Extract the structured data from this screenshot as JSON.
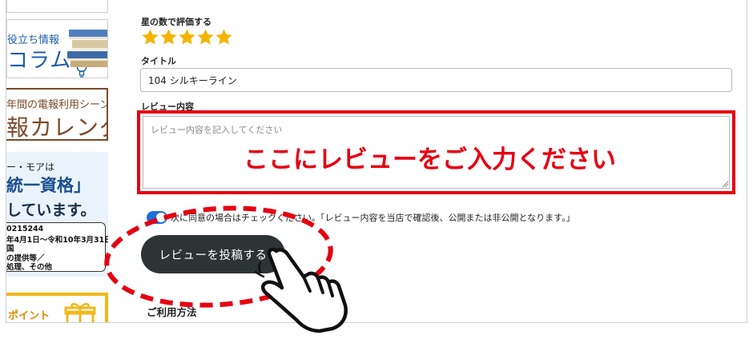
{
  "sidebar": {
    "column_banner": {
      "subtitle": "役立ち情報",
      "title": "コラム"
    },
    "calendar_banner": {
      "subtitle": "年間の電報利用シーン",
      "title": "報カレンダー"
    },
    "license_banner": {
      "line1": "ー・モアは",
      "line2": "統一資格」",
      "line3": "しています。",
      "box_lines": [
        "0215244",
        "年4月1日〜令和10年3月31日",
        "国",
        "の提供等／",
        "処理、その他"
      ]
    },
    "point_banner": {
      "label": "ポイント"
    }
  },
  "form": {
    "rating": {
      "label": "星の数で評価する",
      "value": 5,
      "max": 5,
      "color": "#f5b400"
    },
    "title_field": {
      "label": "タイトル",
      "value": "104 シルキーライン"
    },
    "review_field": {
      "label": "レビュー内容",
      "placeholder": "レビュー内容を記入してください"
    },
    "annotation": "ここにレビューをご入力ください",
    "consent": {
      "checked": true,
      "text": "次に同意の場合はチェックください。「レビュー内容を当店で確認後、公開または非公開となります。」"
    },
    "submit_label": "レビューを投稿する",
    "usage_heading": "ご利用方法"
  },
  "colors": {
    "accent_red": "#e60012",
    "toggle_blue": "#1e6fdc",
    "button_dark": "#2d3436"
  }
}
